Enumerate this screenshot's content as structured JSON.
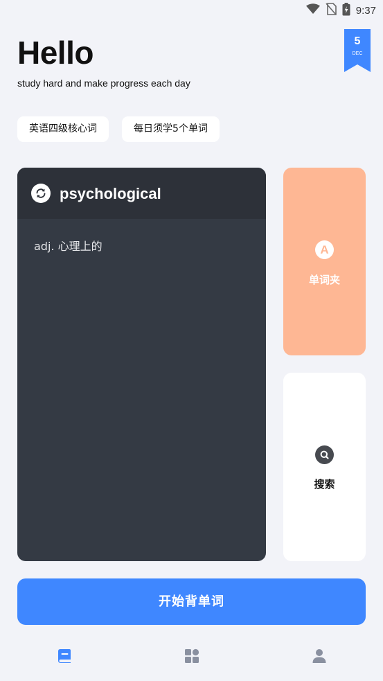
{
  "status_bar": {
    "time": "9:37",
    "icons": [
      "wifi-icon",
      "no-sim-icon",
      "battery-charging-icon"
    ]
  },
  "header": {
    "greeting": "Hello",
    "subtitle": "study hard and make progress each day"
  },
  "date_badge": {
    "day": "5",
    "month": "DEC",
    "color": "#3f87ff"
  },
  "chips": [
    {
      "label": "英语四级核心词"
    },
    {
      "label": "每日须学5个单词"
    }
  ],
  "word_card": {
    "refresh_icon": "refresh-icon",
    "word": "psychological",
    "definition": "adj. 心理上的"
  },
  "favorites_card": {
    "icon_letter": "A",
    "label": "单词夹",
    "color": "#feb794"
  },
  "search_card": {
    "icon": "search-icon",
    "label": "搜索"
  },
  "start_button": {
    "label": "开始背单词",
    "color": "#3f87ff"
  },
  "bottom_nav": {
    "items": [
      {
        "icon": "book-icon",
        "active": true
      },
      {
        "icon": "grid-icon",
        "active": false
      },
      {
        "icon": "person-icon",
        "active": false
      }
    ],
    "active_color": "#3f87ff",
    "inactive_color": "#8a90a0"
  }
}
